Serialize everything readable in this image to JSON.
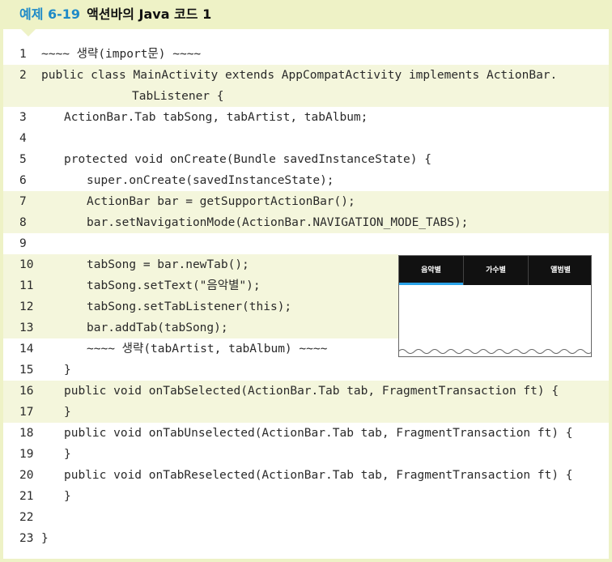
{
  "header": {
    "number": "예제 6-19",
    "title": "액션바의 Java 코드 1"
  },
  "code_lines": [
    {
      "n": "1",
      "text": "~~~~ 생략(import문) ~~~~",
      "indent": 0,
      "hl": false
    },
    {
      "n": "2",
      "text": "public class MainActivity extends AppCompatActivity implements ActionBar.",
      "indent": 0,
      "hl": true
    },
    {
      "n": "",
      "text": "TabListener {",
      "indent": 4,
      "hl": true
    },
    {
      "n": "3",
      "text": "ActionBar.Tab tabSong, tabArtist, tabAlbum;",
      "indent": 1,
      "hl": false
    },
    {
      "n": "4",
      "text": "",
      "indent": 0,
      "hl": false
    },
    {
      "n": "5",
      "text": "protected void onCreate(Bundle savedInstanceState) {",
      "indent": 1,
      "hl": false
    },
    {
      "n": "6",
      "text": "super.onCreate(savedInstanceState);",
      "indent": 2,
      "hl": false
    },
    {
      "n": "7",
      "text": "ActionBar bar = getSupportActionBar();",
      "indent": 2,
      "hl": true
    },
    {
      "n": "8",
      "text": "bar.setNavigationMode(ActionBar.NAVIGATION_MODE_TABS);",
      "indent": 2,
      "hl": true
    },
    {
      "n": "9",
      "text": "",
      "indent": 0,
      "hl": false
    },
    {
      "n": "10",
      "text": "tabSong = bar.newTab();",
      "indent": 2,
      "hl": true,
      "short": true
    },
    {
      "n": "11",
      "text": "tabSong.setText(\"음악별\");",
      "indent": 2,
      "hl": true,
      "short": true
    },
    {
      "n": "12",
      "text": "tabSong.setTabListener(this);",
      "indent": 2,
      "hl": true,
      "short": true
    },
    {
      "n": "13",
      "text": "bar.addTab(tabSong);",
      "indent": 2,
      "hl": true,
      "short": true
    },
    {
      "n": "14",
      "text": "~~~~ 생략(tabArtist, tabAlbum) ~~~~",
      "indent": 2,
      "hl": false
    },
    {
      "n": "15",
      "text": "}",
      "indent": 1,
      "hl": false
    },
    {
      "n": "16",
      "text": "public void onTabSelected(ActionBar.Tab tab, FragmentTransaction ft) {",
      "indent": 1,
      "hl": true
    },
    {
      "n": "17",
      "text": "}",
      "indent": 1,
      "hl": true
    },
    {
      "n": "18",
      "text": "public void onTabUnselected(ActionBar.Tab tab, FragmentTransaction ft) {",
      "indent": 1,
      "hl": false
    },
    {
      "n": "19",
      "text": "}",
      "indent": 1,
      "hl": false
    },
    {
      "n": "20",
      "text": "public void onTabReselected(ActionBar.Tab tab, FragmentTransaction ft) {",
      "indent": 1,
      "hl": false
    },
    {
      "n": "21",
      "text": "}",
      "indent": 1,
      "hl": false
    },
    {
      "n": "22",
      "text": "",
      "indent": 0,
      "hl": false
    },
    {
      "n": "23",
      "text": "}",
      "indent": 0,
      "hl": false
    }
  ],
  "preview": {
    "tabs": [
      "음악별",
      "가수별",
      "앨범별"
    ],
    "selected_tab": "음악별",
    "accent_color": "#2aa3e8"
  },
  "colors": {
    "header_bg": "#eef2c6",
    "highlight_bg": "#f4f6dc",
    "number_color": "#1e8ac8"
  }
}
